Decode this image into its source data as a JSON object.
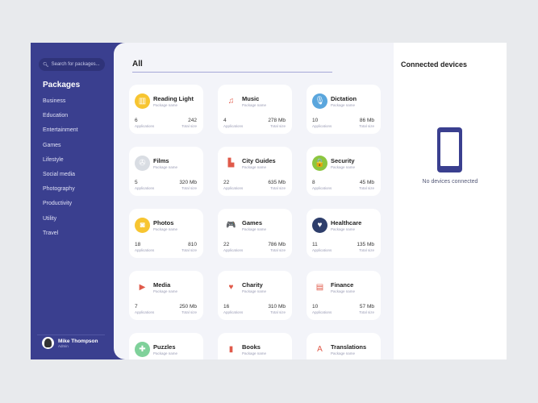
{
  "sidebar": {
    "search_placeholder": "Search for packages...",
    "title": "Packages",
    "categories": [
      "Business",
      "Education",
      "Entertainment",
      "Games",
      "Lifestyle",
      "Social media",
      "Photography",
      "Productivity",
      "Utility",
      "Travel"
    ],
    "user": {
      "name": "Mike Thompson",
      "role": "Admin"
    }
  },
  "main": {
    "tab": "All",
    "subtitle": "Package name",
    "apps_label": "Applications",
    "size_label": "Total size",
    "cards": [
      {
        "name": "Reading Light",
        "count": "6",
        "size": "242",
        "icon": "books-icon",
        "color": "#f7c531",
        "glyph": "▥"
      },
      {
        "name": "Music",
        "count": "4",
        "size": "278 Mb",
        "icon": "music-note-icon",
        "color": "#ffffff",
        "glyph": "♫"
      },
      {
        "name": "Dictation",
        "count": "10",
        "size": "86 Mb",
        "icon": "microphone-icon",
        "color": "#5aa6dd",
        "glyph": "🎙"
      },
      {
        "name": "Films",
        "count": "5",
        "size": "320 Mb",
        "icon": "film-reel-icon",
        "color": "#d9dde3",
        "glyph": "✇"
      },
      {
        "name": "City Guides",
        "count": "22",
        "size": "635 Mb",
        "icon": "city-icon",
        "color": "#ffffff",
        "glyph": "▙"
      },
      {
        "name": "Security",
        "count": "8",
        "size": "45 Mb",
        "icon": "lock-icon",
        "color": "#8cc63f",
        "glyph": "🔒"
      },
      {
        "name": "Photos",
        "count": "18",
        "size": "810",
        "icon": "camera-icon",
        "color": "#f7c531",
        "glyph": "◙"
      },
      {
        "name": "Games",
        "count": "22",
        "size": "786 Mb",
        "icon": "gamepad-icon",
        "color": "#ffffff",
        "glyph": "🎮"
      },
      {
        "name": "Healthcare",
        "count": "11",
        "size": "135 Mb",
        "icon": "heart-pulse-icon",
        "color": "#2e3e6b",
        "glyph": "♥"
      },
      {
        "name": "Media",
        "count": "7",
        "size": "250 Mb",
        "icon": "media-icon",
        "color": "#ffffff",
        "glyph": "▶"
      },
      {
        "name": "Charity",
        "count": "16",
        "size": "310 Mb",
        "icon": "charity-heart-icon",
        "color": "#ffffff",
        "glyph": "♥"
      },
      {
        "name": "Finance",
        "count": "10",
        "size": "57 Mb",
        "icon": "wallet-icon",
        "color": "#ffffff",
        "glyph": "▤"
      },
      {
        "name": "Puzzles",
        "count": "",
        "size": "",
        "icon": "puzzle-icon",
        "color": "#7fd19a",
        "glyph": "✚"
      },
      {
        "name": "Books",
        "count": "",
        "size": "",
        "icon": "book-icon",
        "color": "#ffffff",
        "glyph": "▮"
      },
      {
        "name": "Translations",
        "count": "",
        "size": "",
        "icon": "translate-icon",
        "color": "#ffffff",
        "glyph": "A"
      }
    ]
  },
  "devices": {
    "title": "Connected devices",
    "empty": "No devices connected"
  }
}
